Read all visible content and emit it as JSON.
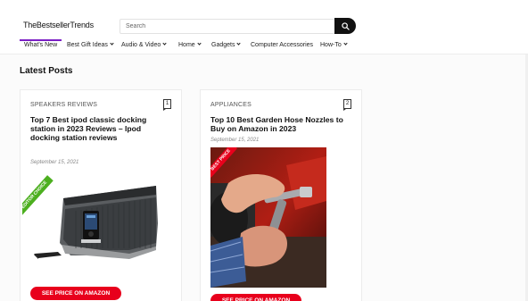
{
  "site": {
    "logo": "TheBestsellerTrends"
  },
  "search": {
    "placeholder": "Search",
    "icon": "search-icon"
  },
  "nav": {
    "items": [
      {
        "label": "What's New",
        "has_dropdown": false,
        "active": true
      },
      {
        "label": "Best Gift Ideas",
        "has_dropdown": true
      },
      {
        "label": "Audio & Video",
        "has_dropdown": true
      },
      {
        "label": "Home",
        "has_dropdown": true
      },
      {
        "label": "Gadgets",
        "has_dropdown": true
      },
      {
        "label": "Computer Accessories",
        "has_dropdown": false
      },
      {
        "label": "How-To",
        "has_dropdown": true
      }
    ],
    "active_color": "#7b1fc4"
  },
  "main": {
    "section_title": "Latest Posts",
    "posts": [
      {
        "number": "1",
        "category": "SPEAKERS REVIEWS",
        "title_lines": [
          "Top 7 Best ipod classic docking",
          "station in 2023 Reviews – Ipod",
          "docking station reviews"
        ],
        "date": "September 15, 2021",
        "badge": "EDITOR CHOICE",
        "badge_color": "#4caf1f",
        "cta": "SEE PRICE ON AMAZON"
      },
      {
        "number": "2",
        "category": "APPLIANCES",
        "title_lines": [
          "Top 10 Best Garden Hose Nozzles to",
          "Buy on Amazon in 2023"
        ],
        "date": "September 15, 2021",
        "badge": "BEST PRICE",
        "badge_color": "#e8001c",
        "cta": "SEE PRICE ON AMAZON"
      }
    ]
  },
  "colors": {
    "cta": "#e8001c",
    "search_button": "#111111"
  }
}
